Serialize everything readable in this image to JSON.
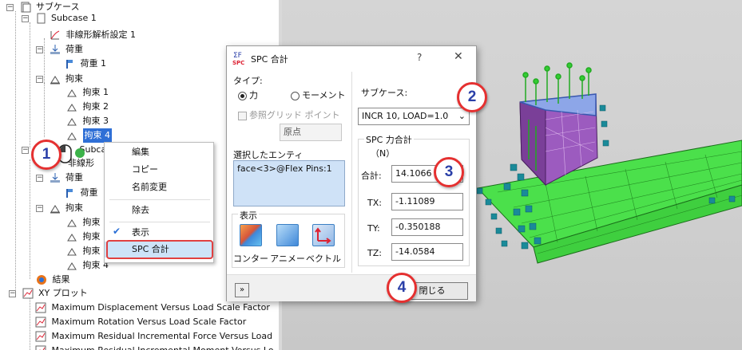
{
  "tree": {
    "items": [
      {
        "label": "サブケース"
      },
      {
        "label": "Subcase 1"
      },
      {
        "label": "非線形解析設定 1"
      },
      {
        "label": "荷重"
      },
      {
        "label": "荷重 1"
      },
      {
        "label": "拘束"
      },
      {
        "label": "拘束 1"
      },
      {
        "label": "拘束 2"
      },
      {
        "label": "拘束 3"
      },
      {
        "label": "拘束 4"
      },
      {
        "label": "Subcase"
      },
      {
        "label": "非線形"
      },
      {
        "label": "荷重"
      },
      {
        "label": "荷重"
      },
      {
        "label": "拘束"
      },
      {
        "label": "拘束"
      },
      {
        "label": "拘束"
      },
      {
        "label": "拘束"
      },
      {
        "label": "拘束 4"
      },
      {
        "label": "結果"
      },
      {
        "label": "XY プロット"
      },
      {
        "label": "Maximum Displacement Versus Load Scale Factor"
      },
      {
        "label": "Maximum Rotation Versus Load Scale Factor"
      },
      {
        "label": "Maximum Residual Incremental Force Versus Load"
      },
      {
        "label": "Maximum Residual Incremental Moment Versus Lo"
      }
    ]
  },
  "context_menu": {
    "items": [
      "編集",
      "コピー",
      "名前変更",
      "除去",
      "表示",
      "SPC 合計"
    ]
  },
  "dialog": {
    "icon_text": "SPC",
    "title": "SPC 合計",
    "help": "?",
    "close": "✕",
    "type_label": "タイプ:",
    "radio_force": "力",
    "radio_moment": "モーメント",
    "ref_grid_point": "参照グリッド ポイント",
    "origin": "原点",
    "selected_entity_label": "選択したエンティ",
    "selected_entity_value": "face<3>@Flex Pins:1",
    "display_label": "表示",
    "display_buttons": [
      "コンター",
      "アニメー",
      "ベクトル"
    ],
    "subcase_label": "サブケース:",
    "subcase_value": "INCR 10, LOAD=1.0",
    "spc_group_title": "SPC 力合計",
    "unit": "（N）",
    "total_label": "合計:",
    "total_value": "14.1066",
    "tx_label": "TX:",
    "tx_value": "-1.11089",
    "ty_label": "TY:",
    "ty_value": "-0.350188",
    "tz_label": "TZ:",
    "tz_value": "-14.0584",
    "close_button": "閉じる",
    "collapse_button": "»"
  },
  "callouts": [
    "1",
    "2",
    "3",
    "4"
  ],
  "colors": {
    "selection": "#2f6fd6",
    "callout_border": "#e53030",
    "callout_text": "#2a3fa8",
    "mesh_green": "#33dd33",
    "mesh_purple": "#8844aa",
    "constraint_teal": "#1a8a99"
  }
}
